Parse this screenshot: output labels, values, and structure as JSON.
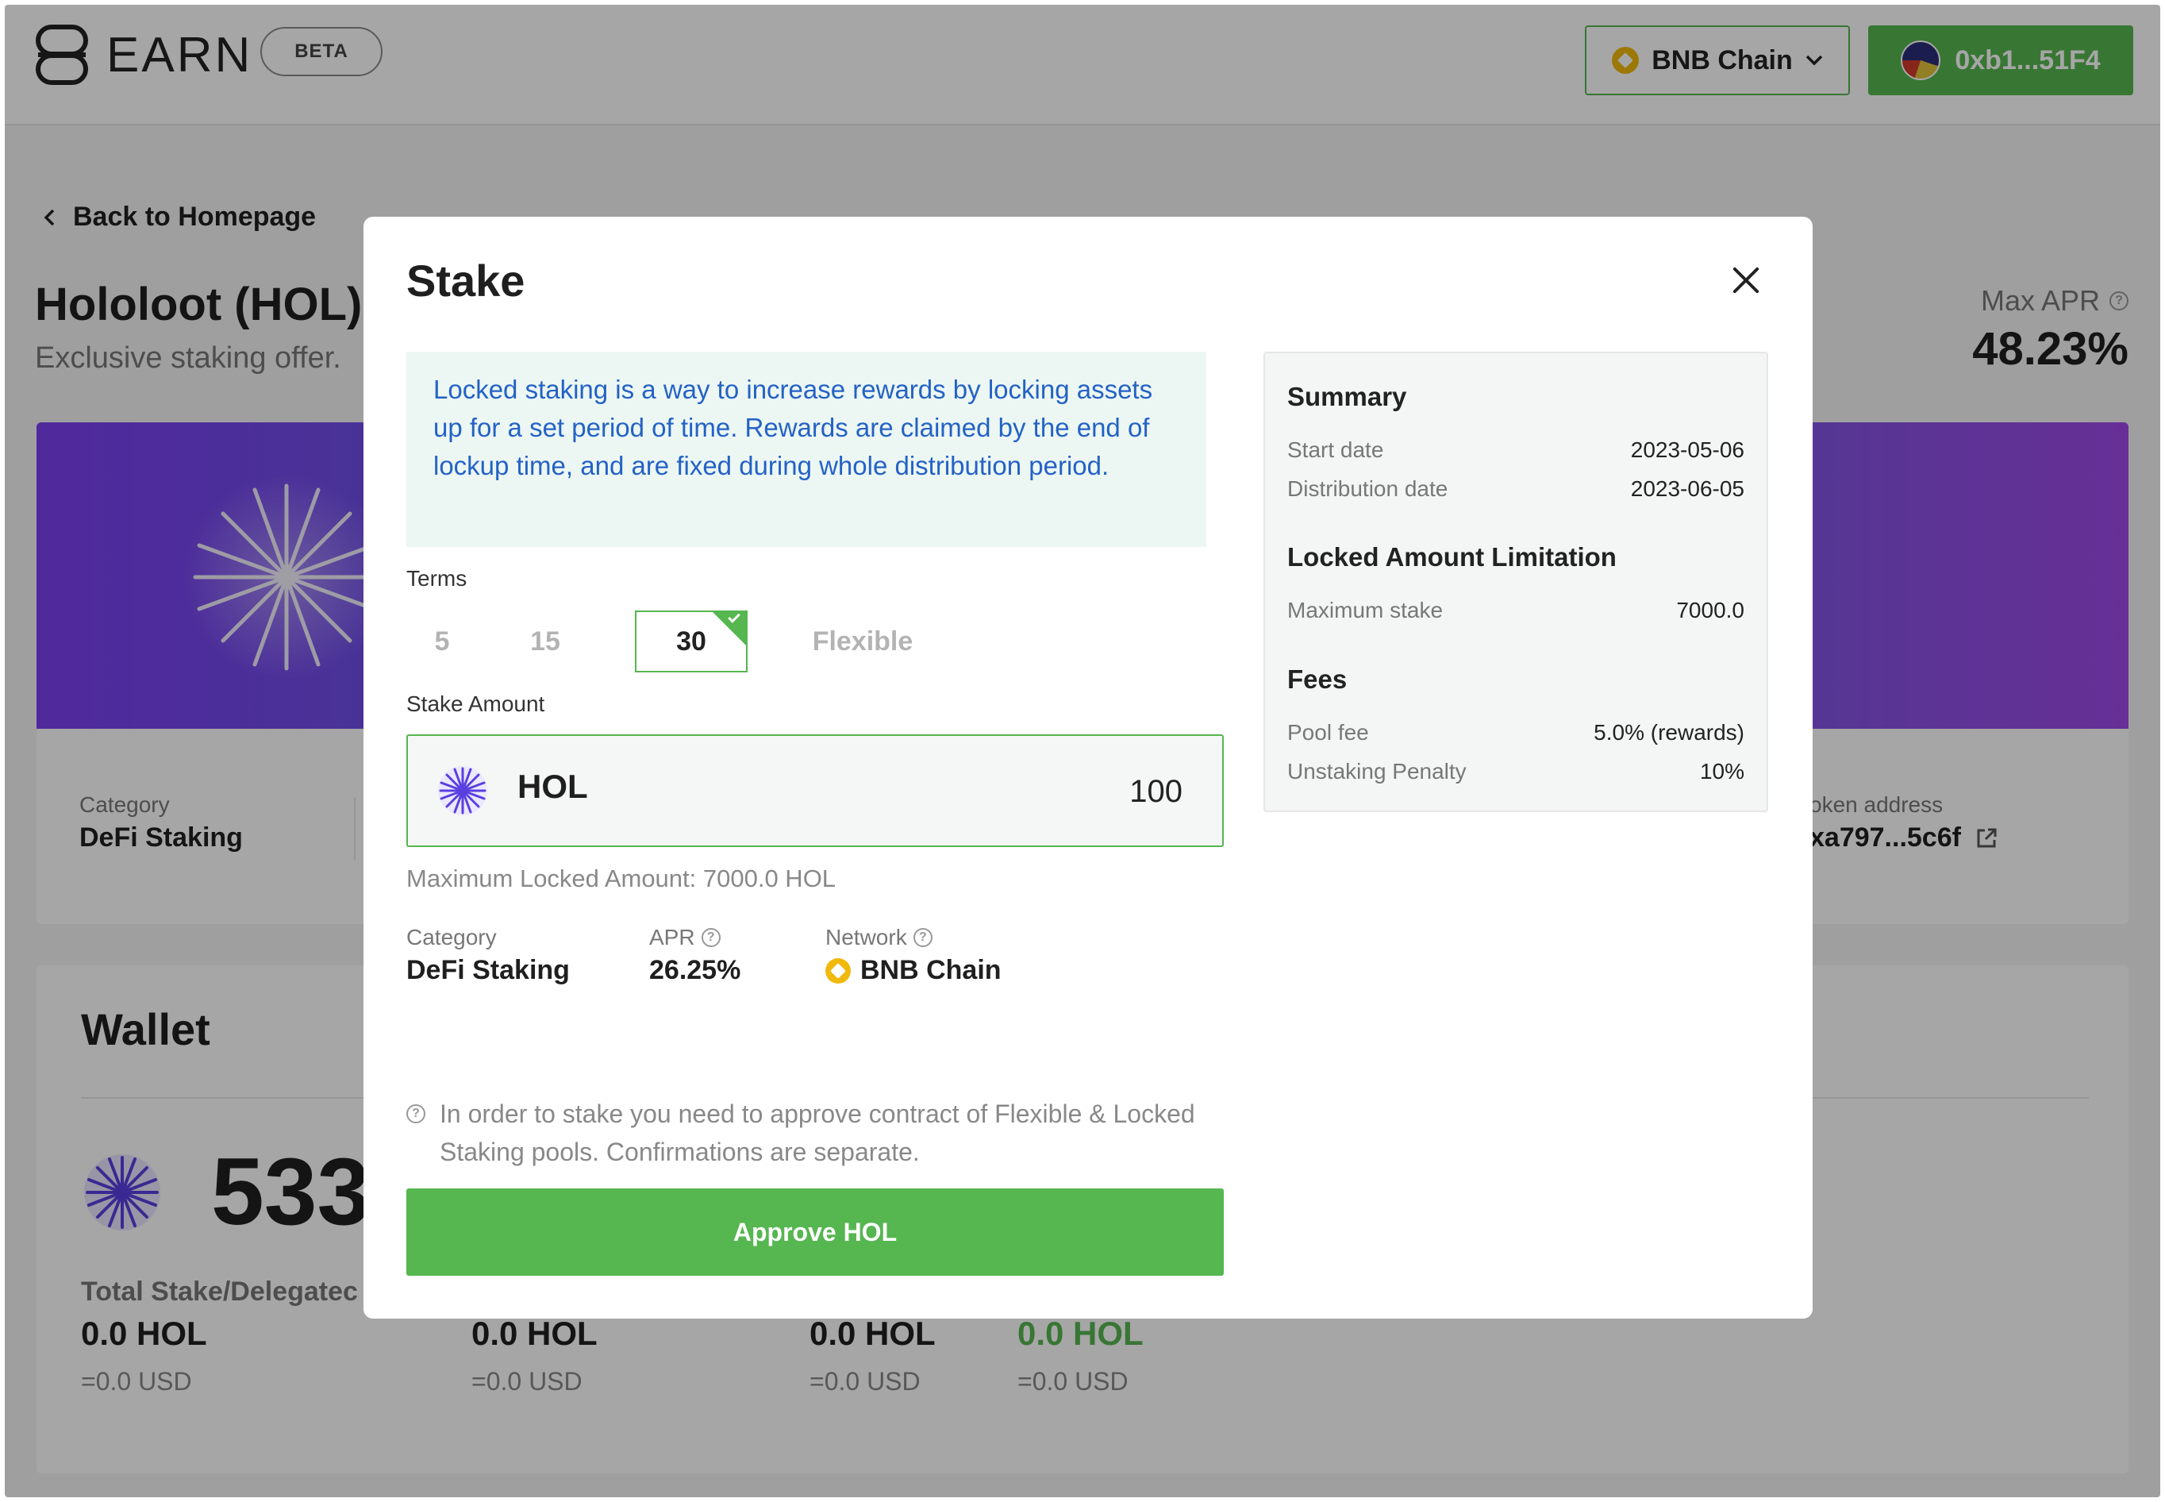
{
  "header": {
    "logo_text": "EARN",
    "beta": "BETA",
    "chain": "BNB Chain",
    "wallet": "0xb1...51F4"
  },
  "page": {
    "back": "Back to Homepage",
    "title": "Hololoot (HOL)",
    "subtitle": "Exclusive staking offer.",
    "max_apr_label": "Max APR",
    "max_apr_value": "48.23%",
    "info": {
      "category_label": "Category",
      "category_value": "DeFi Staking",
      "token_address_label": "oken address",
      "token_address_value": "xa797...5c6f"
    },
    "wallet": {
      "title": "Wallet",
      "balance_partial": "533",
      "total_label": "Total Stake/Delegatec",
      "stats": [
        {
          "main": "0.0 HOL",
          "sub": "=0.0 USD"
        },
        {
          "main": "0.0 HOL",
          "sub": "=0.0 USD"
        },
        {
          "main": "0.0 HOL",
          "sub": "=0.0 USD"
        },
        {
          "main": "0.0 HOL",
          "sub": "=0.0 USD"
        }
      ]
    }
  },
  "modal": {
    "title": "Stake",
    "notice": "Locked staking is a way to increase rewards by locking assets up for a set period of time. Rewards are claimed by the end of lockup time, and are fixed during whole distribution period.",
    "terms_label": "Terms",
    "terms": [
      "5",
      "15",
      "30",
      "Flexible"
    ],
    "selected_term": "30",
    "amount_label": "Stake Amount",
    "token": "HOL",
    "amount": "100",
    "max_locked": "Maximum Locked Amount: 7000.0 HOL",
    "meta": {
      "category_label": "Category",
      "category_value": "DeFi Staking",
      "apr_label": "APR",
      "apr_value": "26.25%",
      "network_label": "Network",
      "network_value": "BNB Chain"
    },
    "approve_note": "In order to stake you need to approve contract of Flexible & Locked Staking pools. Confirmations are separate.",
    "approve_button": "Approve HOL",
    "summary": {
      "title": "Summary",
      "start_date_label": "Start date",
      "start_date": "2023-05-06",
      "distribution_date_label": "Distribution date",
      "distribution_date": "2023-06-05",
      "limitation_title": "Locked Amount Limitation",
      "max_stake_label": "Maximum stake",
      "max_stake": "7000.0",
      "fees_title": "Fees",
      "pool_fee_label": "Pool fee",
      "pool_fee": "5.0% (rewards)",
      "penalty_label": "Unstaking Penalty",
      "penalty": "10%"
    }
  },
  "colors": {
    "accent": "#56b650",
    "notice_text": "#2462c5",
    "bnb": "#f0b90b"
  }
}
